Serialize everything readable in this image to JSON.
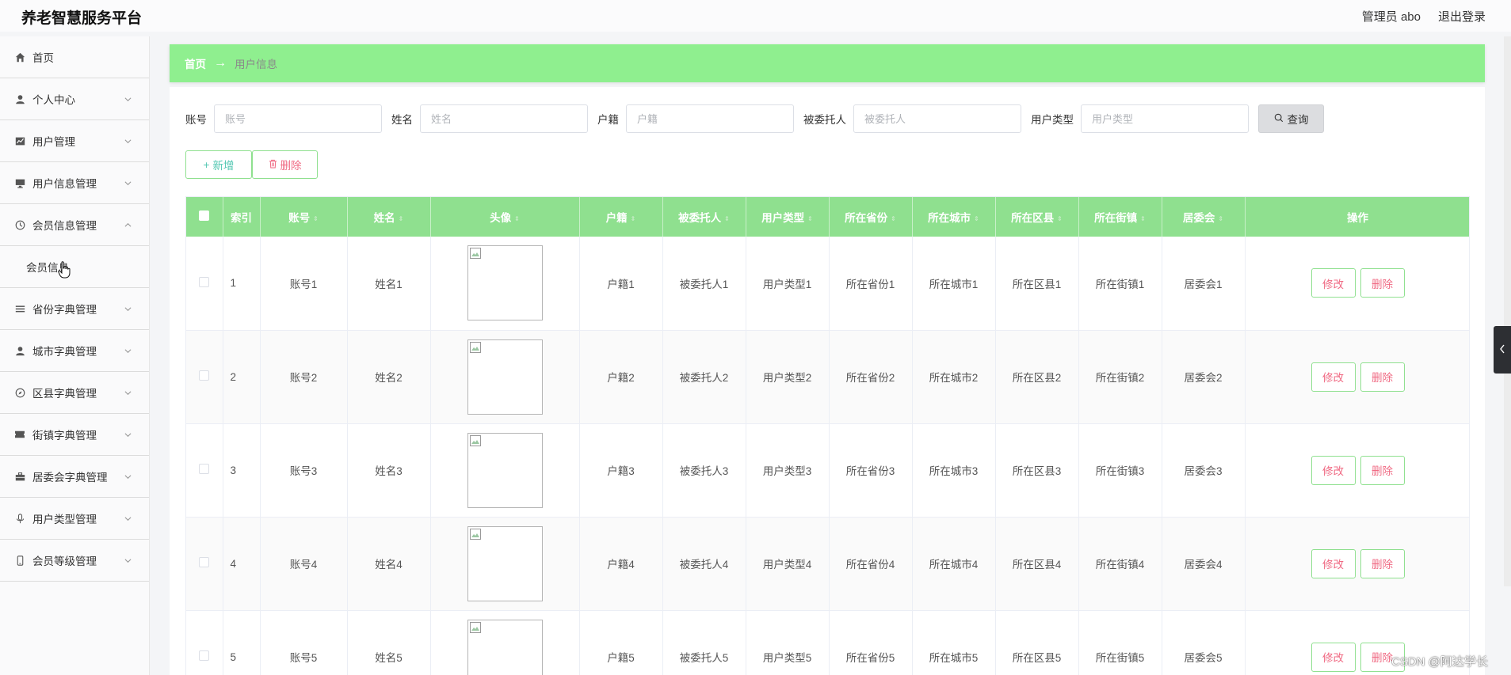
{
  "app": {
    "title": "养老智慧服务平台"
  },
  "header": {
    "admin_label": "管理员 abo",
    "logout_label": "退出登录"
  },
  "sidebar": {
    "items": [
      {
        "label": "首页",
        "icon": "home-icon",
        "expandable": false
      },
      {
        "label": "个人中心",
        "icon": "user-icon",
        "expandable": true
      },
      {
        "label": "用户管理",
        "icon": "chart-icon",
        "expandable": true
      },
      {
        "label": "用户信息管理",
        "icon": "monitor-icon",
        "expandable": true
      },
      {
        "label": "会员信息管理",
        "icon": "clock-icon",
        "expandable": true,
        "expanded": true,
        "submenu": [
          "会员信息"
        ]
      },
      {
        "label": "省份字典管理",
        "icon": "list-icon",
        "expandable": true
      },
      {
        "label": "城市字典管理",
        "icon": "user-icon",
        "expandable": true
      },
      {
        "label": "区县字典管理",
        "icon": "compass-icon",
        "expandable": true
      },
      {
        "label": "街镇字典管理",
        "icon": "ticket-icon",
        "expandable": true
      },
      {
        "label": "居委会字典管理",
        "icon": "briefcase-icon",
        "expandable": true
      },
      {
        "label": "用户类型管理",
        "icon": "microphone-icon",
        "expandable": true
      },
      {
        "label": "会员等级管理",
        "icon": "mobile-icon",
        "expandable": true
      }
    ]
  },
  "breadcrumb": {
    "home": "首页",
    "current": "用户信息"
  },
  "search": {
    "fields": [
      {
        "label": "账号",
        "placeholder": "账号",
        "value": ""
      },
      {
        "label": "姓名",
        "placeholder": "姓名",
        "value": ""
      },
      {
        "label": "户籍",
        "placeholder": "户籍",
        "value": ""
      },
      {
        "label": "被委托人",
        "placeholder": "被委托人",
        "value": ""
      },
      {
        "label": "用户类型",
        "placeholder": "用户类型",
        "value": ""
      }
    ],
    "query_label": "查询"
  },
  "actions": {
    "add_label": "新增",
    "delete_label": "删除"
  },
  "table": {
    "columns": [
      "索引",
      "账号",
      "姓名",
      "头像",
      "户籍",
      "被委托人",
      "用户类型",
      "所在省份",
      "所在城市",
      "所在区县",
      "所在街镇",
      "居委会",
      "操作"
    ],
    "edit_label": "修改",
    "delete_label": "删除",
    "rows": [
      {
        "index": "1",
        "account": "账号1",
        "name": "姓名1",
        "huji": "户籍1",
        "trustee": "被委托人1",
        "type": "用户类型1",
        "province": "所在省份1",
        "city": "所在城市1",
        "county": "所在区县1",
        "town": "所在街镇1",
        "committee": "居委会1"
      },
      {
        "index": "2",
        "account": "账号2",
        "name": "姓名2",
        "huji": "户籍2",
        "trustee": "被委托人2",
        "type": "用户类型2",
        "province": "所在省份2",
        "city": "所在城市2",
        "county": "所在区县2",
        "town": "所在街镇2",
        "committee": "居委会2"
      },
      {
        "index": "3",
        "account": "账号3",
        "name": "姓名3",
        "huji": "户籍3",
        "trustee": "被委托人3",
        "type": "用户类型3",
        "province": "所在省份3",
        "city": "所在城市3",
        "county": "所在区县3",
        "town": "所在街镇3",
        "committee": "居委会3"
      },
      {
        "index": "4",
        "account": "账号4",
        "name": "姓名4",
        "huji": "户籍4",
        "trustee": "被委托人4",
        "type": "用户类型4",
        "province": "所在省份4",
        "city": "所在城市4",
        "county": "所在区县4",
        "town": "所在街镇4",
        "committee": "居委会4"
      },
      {
        "index": "5",
        "account": "账号5",
        "name": "姓名5",
        "huji": "户籍5",
        "trustee": "被委托人5",
        "type": "用户类型5",
        "province": "所在省份5",
        "city": "所在城市5",
        "county": "所在区县5",
        "town": "所在街镇5",
        "committee": "居委会5"
      }
    ]
  },
  "watermark": "CSDN @阿达学长",
  "colors": {
    "accent_green": "#8fef8f",
    "header_green": "#8fe08f",
    "danger_pink": "#f06b84",
    "teal": "#53c7b2"
  }
}
